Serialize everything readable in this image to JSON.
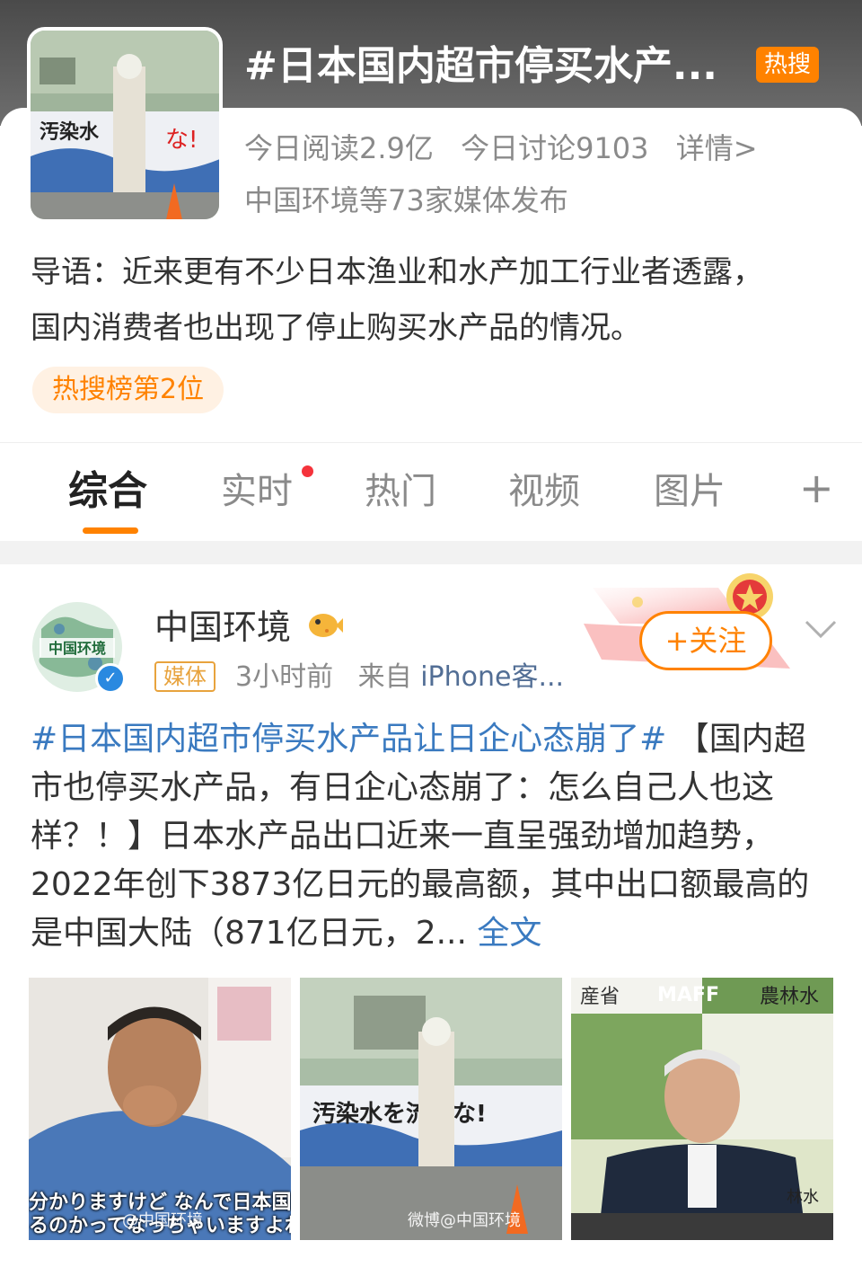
{
  "topic": {
    "title": "#日本国内超市停买水产...",
    "badge": "热搜",
    "read_today": "今日阅读2.9亿",
    "discuss_today": "今日讨论9103",
    "details": "详情>",
    "media": "中国环境等73家媒体发布",
    "intro_line1": "导语：近来更有不少日本渔业和水产加工行业者透露，",
    "intro_line2": "国内消费者也出现了停止购买水产品的情况。",
    "rank": "热搜榜第2位"
  },
  "tabs": [
    {
      "label": "综合",
      "active": true
    },
    {
      "label": "实时",
      "active": false
    },
    {
      "label": "热门",
      "active": false
    },
    {
      "label": "视频",
      "active": false
    },
    {
      "label": "图片",
      "active": false
    },
    {
      "label": "+",
      "active": false
    }
  ],
  "post": {
    "author": "中国环境",
    "avatar_text": "中国环境",
    "media_tag": "媒体",
    "time": "3小时前",
    "from_label": "来自",
    "source": "iPhone客...",
    "follow": "+关注",
    "hashtag": "#日本国内超市停买水产品让日企心态崩了#",
    "body": " 【国内超市也停买水产品，有日企心态崩了：怎么自己人也这样？！】日本水产品出口近来一直呈强劲增加趋势，2022年创下3873亿日元的最高额，其中出口额最高的是中国大陆（871亿日元，2...",
    "full_text": " 全文",
    "images": [
      {
        "subtitle1": "分かりますけど なんで日本国民が",
        "subtitle2": "るのかってなっちゃいますよね",
        "watermark": "@中国环境"
      },
      {
        "sign": "汚染水を流すな!",
        "watermark": "微博@中国环境"
      },
      {
        "sign_left": "産省",
        "sign_center": "MAFF",
        "sign_right": "農林水",
        "sign_bottom": "林水"
      }
    ]
  },
  "colors": {
    "accent": "#ff8200",
    "link": "#3a7ac0",
    "hot_dot": "#f5333b"
  }
}
